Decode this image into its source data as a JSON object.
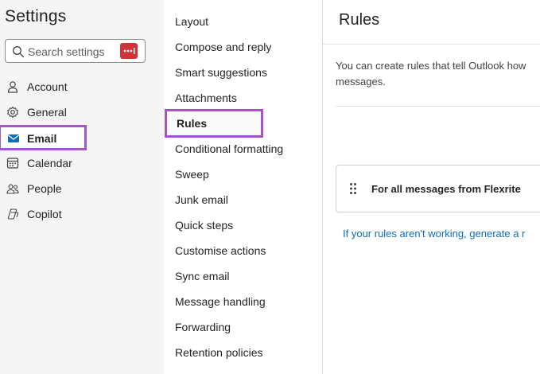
{
  "sidebar": {
    "title": "Settings",
    "search_placeholder": "Search settings",
    "items": [
      {
        "label": "Account",
        "icon": "person-icon"
      },
      {
        "label": "General",
        "icon": "gear-icon"
      },
      {
        "label": "Email",
        "icon": "mail-icon",
        "selected": true
      },
      {
        "label": "Calendar",
        "icon": "calendar-icon"
      },
      {
        "label": "People",
        "icon": "people-icon"
      },
      {
        "label": "Copilot",
        "icon": "copilot-icon"
      }
    ]
  },
  "email_menu": {
    "items": [
      "Layout",
      "Compose and reply",
      "Smart suggestions",
      "Attachments",
      "Rules",
      "Conditional formatting",
      "Sweep",
      "Junk email",
      "Quick steps",
      "Customise actions",
      "Sync email",
      "Message handling",
      "Forwarding",
      "Retention policies"
    ],
    "selected": "Rules"
  },
  "main": {
    "title": "Rules",
    "description_line1": "You can create rules that tell Outlook how",
    "description_line2": "messages.",
    "rule_name": "For all messages from Flexrite",
    "help_link": "If your rules aren't working, generate a r"
  },
  "colors": {
    "accent_highlight": "#a656c4",
    "link": "#0f6cbd",
    "mail_icon": "#0f6cbd",
    "password_icon": "#d13438"
  }
}
